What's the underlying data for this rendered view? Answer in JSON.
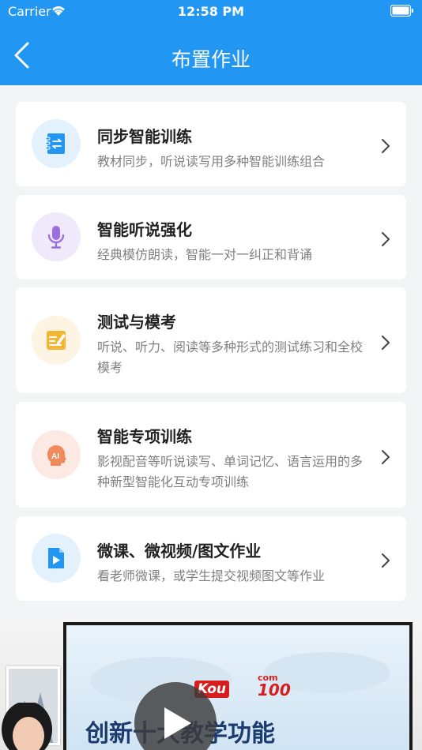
{
  "status_bar": {
    "carrier": "Carrier",
    "time": "12:58 PM"
  },
  "nav": {
    "title": "布置作业",
    "back_icon": "chevron-left-icon"
  },
  "cards": [
    {
      "title": "同步智能训练",
      "desc": "教材同步，听说读写用多种智能训练组合",
      "icon": "sync-book-icon",
      "icon_bg": "#e3f1fd",
      "icon_color": "#2196f3"
    },
    {
      "title": "智能听说强化",
      "desc": "经典模仿朗读，智能一对一纠正和背诵",
      "icon": "microphone-icon",
      "icon_bg": "#f0e9fb",
      "icon_color": "#9c6ee0"
    },
    {
      "title": "测试与模考",
      "desc": "听说、听力、阅读等多种形式的测试练习和全校模考",
      "icon": "test-paper-icon",
      "icon_bg": "#fdf4e3",
      "icon_color": "#f3b532"
    },
    {
      "title": "智能专项训练",
      "desc": "影视配音等听说读写、单词记忆、语言运用的多种新型智能化互动专项训练",
      "icon": "ai-head-icon",
      "icon_bg": "#fde9e3",
      "icon_color": "#f08a5d"
    },
    {
      "title": "微课、微视频/图文作业",
      "desc": "看老师微课，或学生提交视频图文等作业",
      "icon": "video-file-icon",
      "icon_bg": "#e3f1fd",
      "icon_color": "#2196f3"
    }
  ],
  "video": {
    "logo_main": "Kou",
    "logo_com": "com",
    "logo_num": "100",
    "caption": "创新十大教学功能",
    "play_icon": "play-icon"
  },
  "colors": {
    "primary": "#2196f3",
    "background": "#f3f4f6",
    "card": "#ffffff"
  }
}
